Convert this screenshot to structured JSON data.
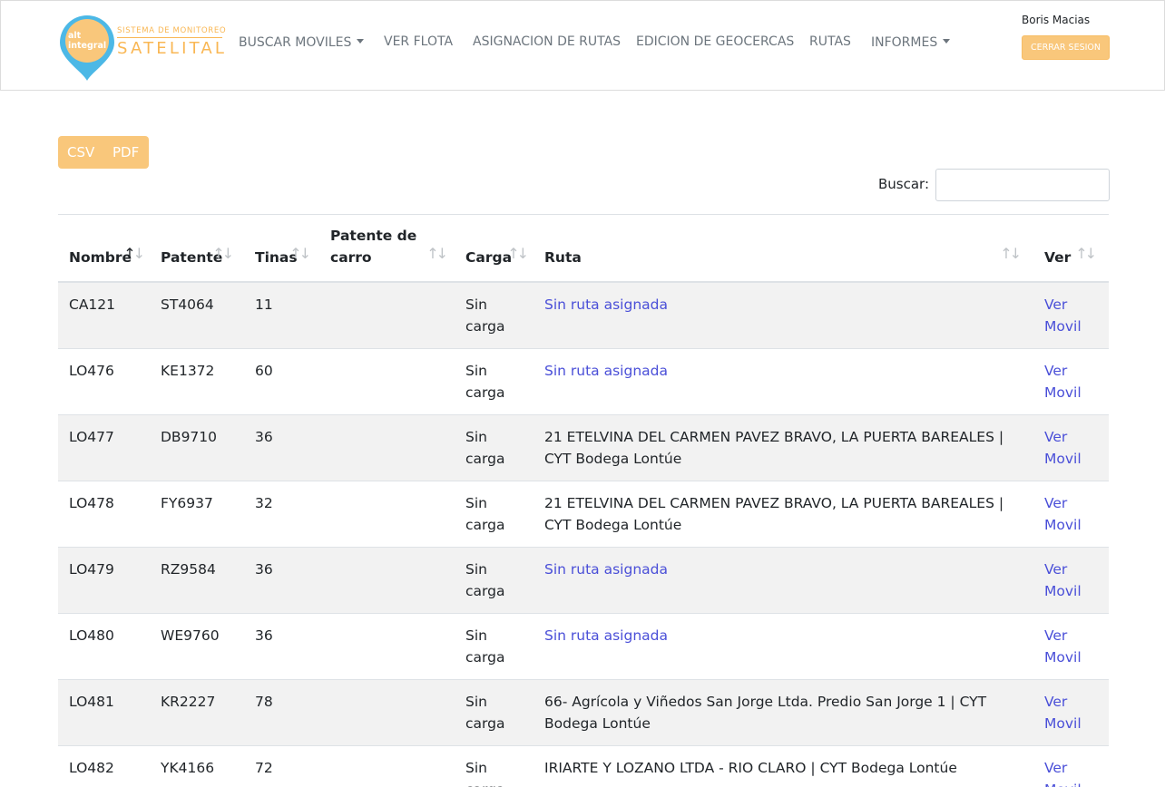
{
  "brand": {
    "logo_badge_line1": "alt",
    "logo_badge_line2": "integral",
    "tagline": "SISTEMA DE MONITOREO",
    "wordmark": "SATELITAL",
    "accent_color": "#f9c77b",
    "logo_blue": "#4cb8e6"
  },
  "nav": {
    "buscar_moviles": "BUSCAR MOVILES",
    "ver_flota": "VER FLOTA",
    "asignacion_rutas": "ASIGNACION DE RUTAS",
    "edicion_geocercas": "EDICION DE GEOCERCAS",
    "rutas": "RUTAS",
    "informes": "INFORMES"
  },
  "user": {
    "name": "Boris Macias",
    "logout_label": "CERRAR SESION"
  },
  "export": {
    "csv_label": "CSV",
    "pdf_label": "PDF"
  },
  "search": {
    "label": "Buscar:",
    "value": "",
    "placeholder": ""
  },
  "table": {
    "columns": {
      "nombre": "Nombre",
      "patente": "Patente",
      "tinas": "Tinas",
      "patente_carro_line1": "Patente de",
      "patente_carro_line2": "carro",
      "carga": "Carga",
      "ruta": "Ruta",
      "ver": "Ver"
    },
    "sort_column": "Nombre",
    "sort_direction": "ascending",
    "rows": [
      {
        "nombre": "CA121",
        "patente": "ST4064",
        "tinas": "11",
        "patente_carro": "",
        "carga": "Sin carga",
        "ruta": "Sin ruta asignada",
        "ruta_is_link": true,
        "ver": "Ver Movil"
      },
      {
        "nombre": "LO476",
        "patente": "KE1372",
        "tinas": "60",
        "patente_carro": "",
        "carga": "Sin carga",
        "ruta": "Sin ruta asignada",
        "ruta_is_link": true,
        "ver": "Ver Movil"
      },
      {
        "nombre": "LO477",
        "patente": "DB9710",
        "tinas": "36",
        "patente_carro": "",
        "carga": "Sin carga",
        "ruta": "21 ETELVINA DEL CARMEN PAVEZ BRAVO, LA PUERTA BAREALES | CYT Bodega Lontúe",
        "ruta_is_link": false,
        "ver": "Ver Movil"
      },
      {
        "nombre": "LO478",
        "patente": "FY6937",
        "tinas": "32",
        "patente_carro": "",
        "carga": "Sin carga",
        "ruta": "21 ETELVINA DEL CARMEN PAVEZ BRAVO, LA PUERTA BAREALES | CYT Bodega Lontúe",
        "ruta_is_link": false,
        "ver": "Ver Movil"
      },
      {
        "nombre": "LO479",
        "patente": "RZ9584",
        "tinas": "36",
        "patente_carro": "",
        "carga": "Sin carga",
        "ruta": "Sin ruta asignada",
        "ruta_is_link": true,
        "ver": "Ver Movil"
      },
      {
        "nombre": "LO480",
        "patente": "WE9760",
        "tinas": "36",
        "patente_carro": "",
        "carga": "Sin carga",
        "ruta": "Sin ruta asignada",
        "ruta_is_link": true,
        "ver": "Ver Movil"
      },
      {
        "nombre": "LO481",
        "patente": "KR2227",
        "tinas": "78",
        "patente_carro": "",
        "carga": "Sin carga",
        "ruta": "66- Agrícola y Viñedos San Jorge Ltda. Predio San Jorge 1 | CYT Bodega Lontúe",
        "ruta_is_link": false,
        "ver": "Ver Movil"
      },
      {
        "nombre": "LO482",
        "patente": "YK4166",
        "tinas": "72",
        "patente_carro": "",
        "carga": "Sin carga",
        "ruta": "IRIARTE Y LOZANO LTDA - RIO CLARO | CYT Bodega Lontúe",
        "ruta_is_link": false,
        "ver": "Ver Movil"
      }
    ]
  }
}
